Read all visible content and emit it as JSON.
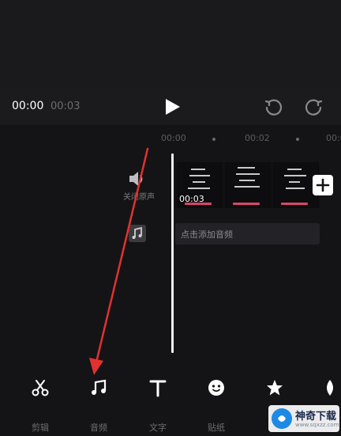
{
  "playback": {
    "current_time": "00:00",
    "total_time": "00:03"
  },
  "ruler": {
    "ticks": [
      "00:00",
      "00:02",
      "00:0"
    ]
  },
  "track_controls": {
    "mute_label": "关闭原声"
  },
  "video_clip": {
    "duration": "00:03"
  },
  "audio_track": {
    "add_label": "点击添加音频"
  },
  "toolbar": {
    "items": [
      {
        "label": "剪辑",
        "icon": "scissors-icon"
      },
      {
        "label": "音频",
        "icon": "music-note-icon"
      },
      {
        "label": "文字",
        "icon": "text-icon"
      },
      {
        "label": "贴纸",
        "icon": "sticker-icon"
      },
      {
        "label": "",
        "icon": "effects-star-icon"
      },
      {
        "label": "",
        "icon": "filter-icon"
      }
    ]
  },
  "annotation": {
    "color": "#e0322f"
  },
  "watermark": {
    "title": "神奇下载",
    "url": "www.sqxzz.com"
  },
  "colors": {
    "accent_pink": "#d9476a",
    "background": "#141416",
    "playhead": "#f2f2f2"
  }
}
